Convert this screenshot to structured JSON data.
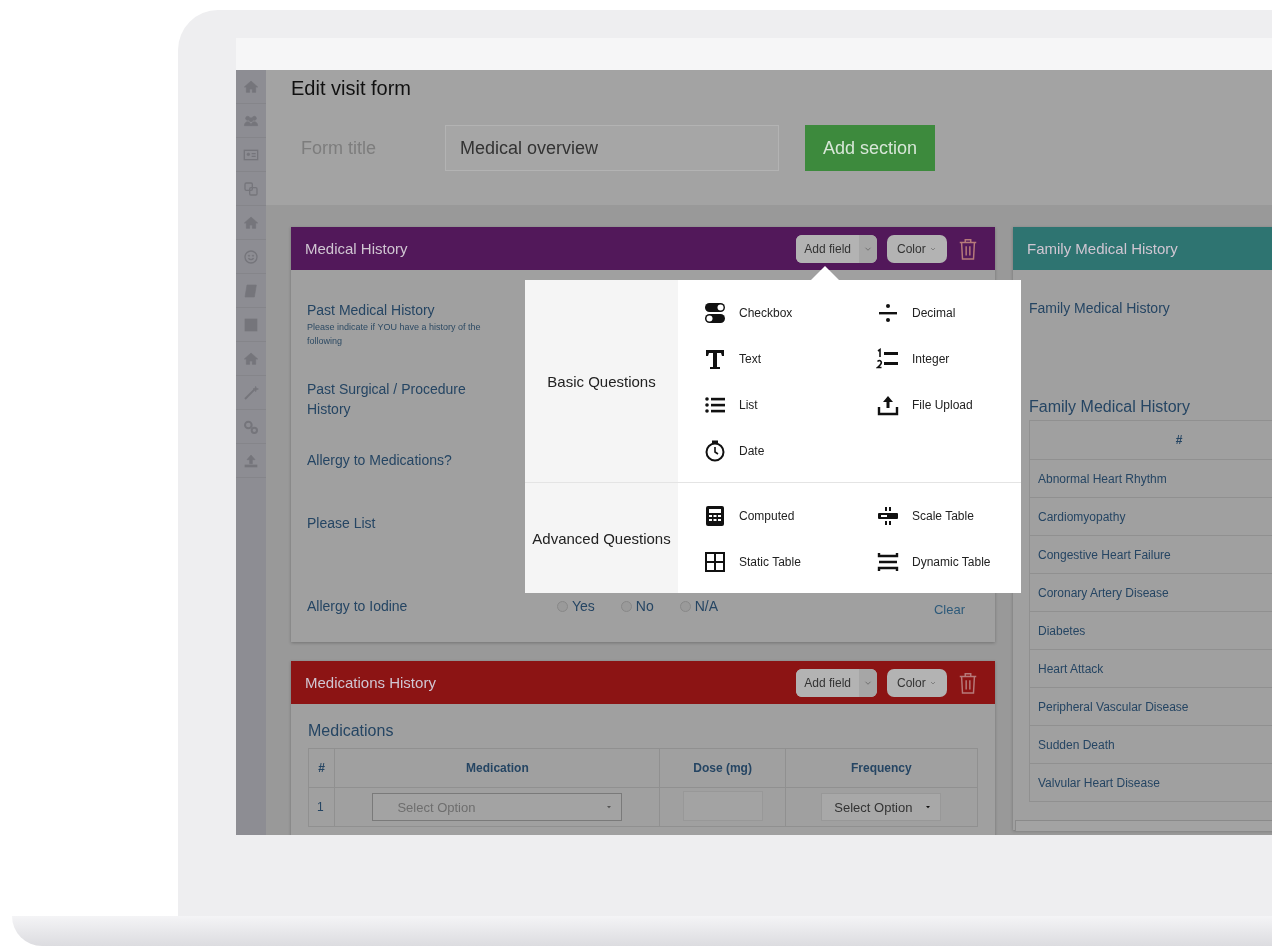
{
  "page": {
    "title": "Edit visit form",
    "form_title_label": "Form title",
    "form_title_value": "Medical overview",
    "add_section_button": "Add section"
  },
  "sections": [
    {
      "kind": "questions",
      "title": "Medical History",
      "color": "#52185a",
      "add_field_button": "Add field",
      "color_button": "Color",
      "questions": [
        {
          "label": "Past Medical History",
          "hint": "Please indicate if YOU have a history of the following"
        },
        {
          "label": "Past Surgical / Procedure History"
        },
        {
          "label": "Allergy to Medications?"
        },
        {
          "label": "Please List"
        },
        {
          "label": "Allergy to Iodine",
          "options": [
            {
              "label": "Yes",
              "selected": false
            },
            {
              "label": "No",
              "selected": false
            },
            {
              "label": "N/A",
              "selected": false
            }
          ],
          "clear": "Clear"
        }
      ]
    },
    {
      "kind": "grid",
      "title": "Medications History",
      "color": "#8c1414",
      "add_field_button": "Add field",
      "color_button": "Color",
      "heading": "Medications",
      "columns": [
        "#",
        "Medication",
        "Dose (mg)",
        "Frequency"
      ],
      "rows": [
        {
          "number": "1",
          "medication": "Select Option",
          "frequency": "Select Option"
        }
      ]
    },
    {
      "kind": "list_table",
      "title": "Family Medical History",
      "color": "#2e7471",
      "label": "Family Medical History",
      "heading": "Family Medical History",
      "columns": [
        "#"
      ],
      "rows": [
        "Abnormal Heart Rhythm",
        "Cardiomyopathy",
        "Congestive Heart Failure",
        "Coronary Artery Disease",
        "Diabetes",
        "Heart Attack",
        "Peripheral Vascular Disease",
        "Sudden Death",
        "Valvular Heart Disease"
      ]
    }
  ],
  "add_field_menu": {
    "groups": [
      {
        "title": "Basic Questions",
        "items": [
          {
            "label": "Checkbox",
            "kind": "checkbox"
          },
          {
            "label": "Decimal",
            "kind": "decimal"
          },
          {
            "label": "Text",
            "kind": "text"
          },
          {
            "label": "Integer",
            "kind": "integer"
          },
          {
            "label": "List",
            "kind": "list"
          },
          {
            "label": "File Upload",
            "kind": "upload"
          },
          {
            "label": "Date",
            "kind": "date"
          }
        ]
      },
      {
        "title": "Advanced Questions",
        "items": [
          {
            "label": "Computed",
            "kind": "computed"
          },
          {
            "label": "Scale Table",
            "kind": "scale"
          },
          {
            "label": "Static Table",
            "kind": "static"
          },
          {
            "label": "Dynamic Table",
            "kind": "dynamic"
          }
        ]
      }
    ]
  }
}
